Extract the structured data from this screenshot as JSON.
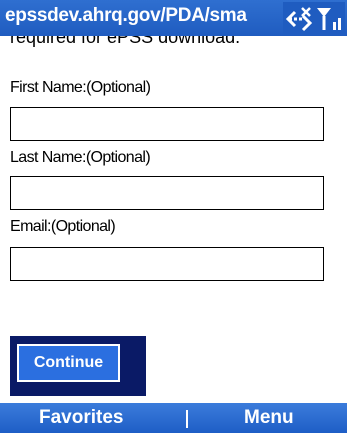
{
  "titlebar": {
    "url": "epssdev.ahrq.gov/PDA/sma",
    "icons": [
      "connectivity-icon",
      "signal-strength-icon"
    ]
  },
  "content": {
    "clipped_text": "required for ePSS download.",
    "first_name_label": "First Name:(Optional)",
    "first_name_value": "",
    "last_name_label": "Last Name:(Optional)",
    "last_name_value": "",
    "email_label": "Email:(Optional)",
    "email_value": "",
    "continue_label": "Continue"
  },
  "softkeys": {
    "left": "Favorites",
    "right": "Menu"
  },
  "colors": {
    "title_bar": "#1f5cc0",
    "button_blue": "#2b6fe0",
    "focus_frame": "#0a1a66"
  }
}
